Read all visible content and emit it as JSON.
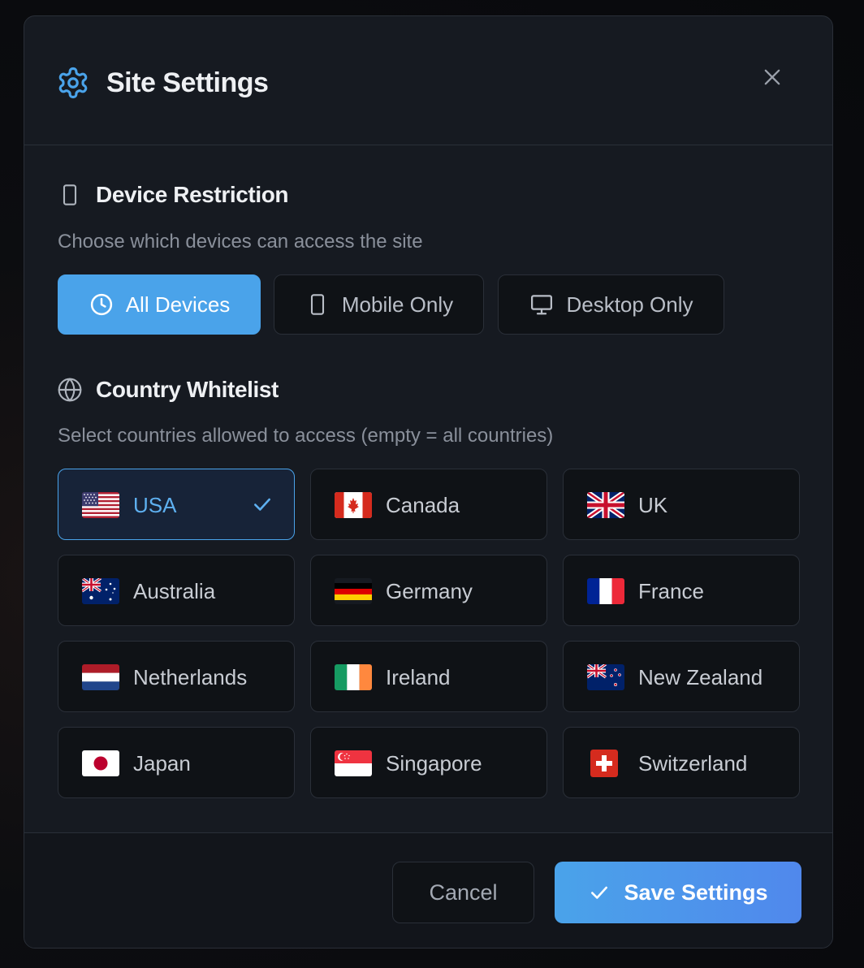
{
  "modal": {
    "title": "Site Settings",
    "title_icon": "gear-icon",
    "close_icon": "close-icon"
  },
  "device_restriction": {
    "title": "Device Restriction",
    "icon": "mobile-icon",
    "description": "Choose which devices can access the site",
    "options": [
      {
        "label": "All Devices",
        "icon": "clock-icon",
        "active": true
      },
      {
        "label": "Mobile Only",
        "icon": "mobile-icon",
        "active": false
      },
      {
        "label": "Desktop Only",
        "icon": "monitor-icon",
        "active": false
      }
    ]
  },
  "country_whitelist": {
    "title": "Country Whitelist",
    "icon": "globe-icon",
    "description": "Select countries allowed to access (empty = all countries)",
    "countries": [
      {
        "name": "USA",
        "flag": "us-flag",
        "selected": true
      },
      {
        "name": "Canada",
        "flag": "ca-flag",
        "selected": false
      },
      {
        "name": "UK",
        "flag": "uk-flag",
        "selected": false
      },
      {
        "name": "Australia",
        "flag": "au-flag",
        "selected": false
      },
      {
        "name": "Germany",
        "flag": "de-flag",
        "selected": false
      },
      {
        "name": "France",
        "flag": "fr-flag",
        "selected": false
      },
      {
        "name": "Netherlands",
        "flag": "nl-flag",
        "selected": false
      },
      {
        "name": "Ireland",
        "flag": "ie-flag",
        "selected": false
      },
      {
        "name": "New Zealand",
        "flag": "nz-flag",
        "selected": false
      },
      {
        "name": "Japan",
        "flag": "jp-flag",
        "selected": false
      },
      {
        "name": "Singapore",
        "flag": "sg-flag",
        "selected": false
      },
      {
        "name": "Switzerland",
        "flag": "ch-flag",
        "selected": false
      }
    ]
  },
  "footer": {
    "cancel_label": "Cancel",
    "save_label": "Save Settings",
    "save_icon": "check-icon"
  },
  "colors": {
    "accent": "#4aa3ea",
    "modal_bg": "#161a21",
    "border": "#2a2f38"
  }
}
